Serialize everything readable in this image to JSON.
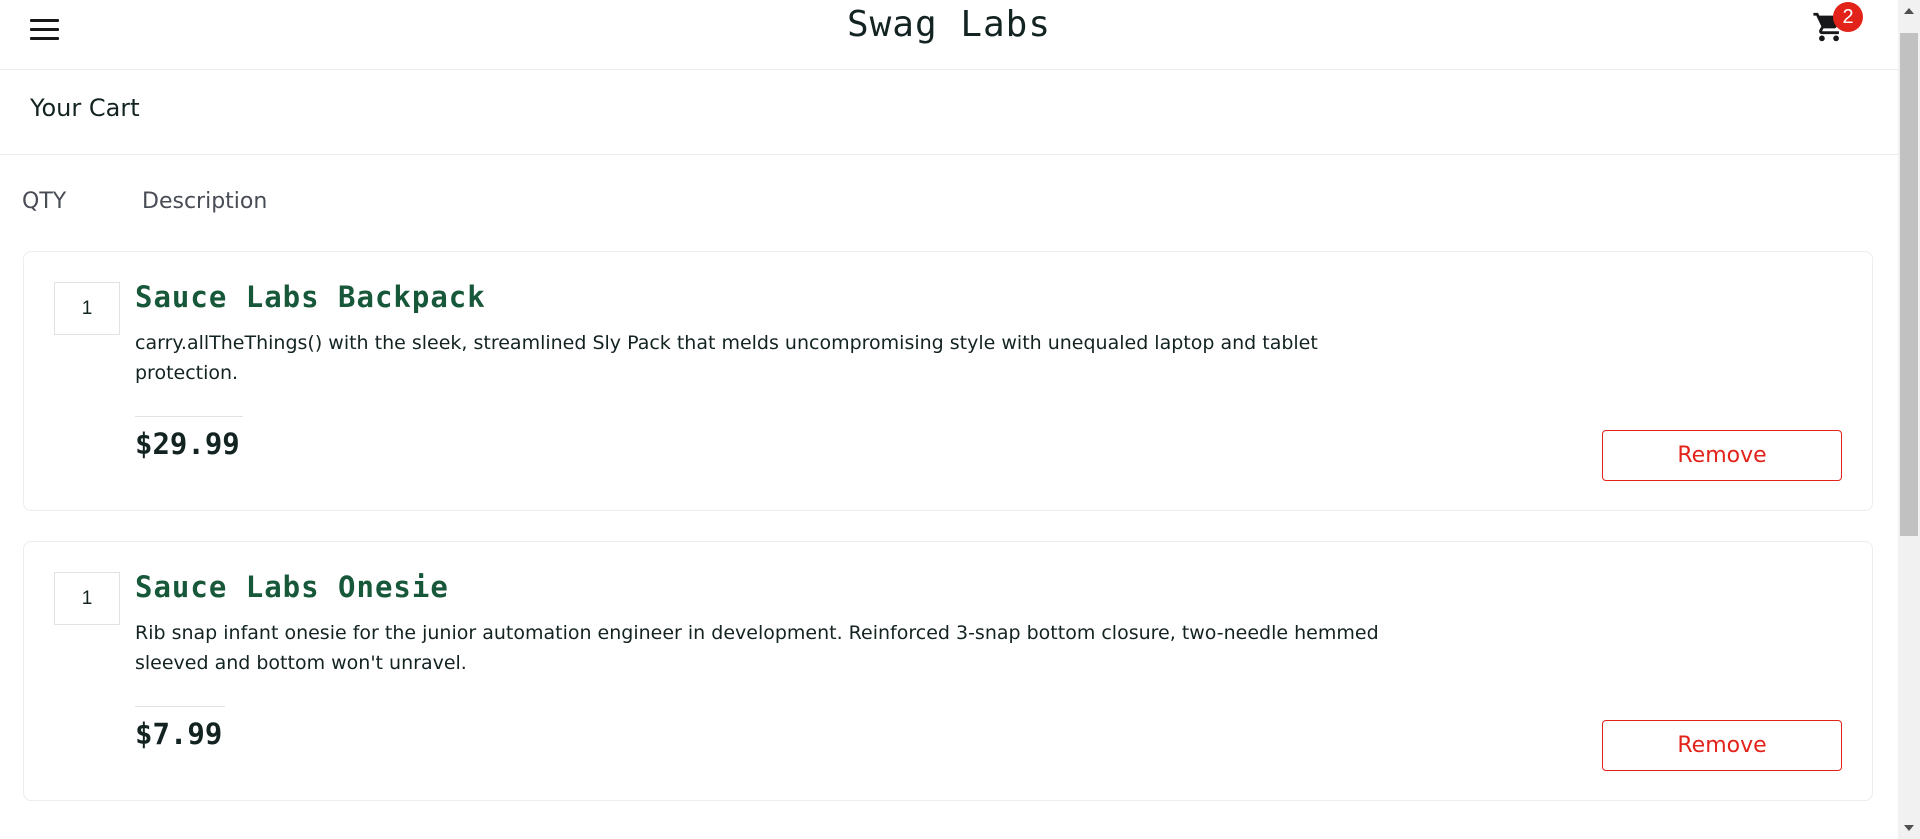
{
  "header": {
    "logo": "Swag Labs",
    "cart_badge": "2"
  },
  "secondary_header": {
    "title": "Your Cart"
  },
  "cart_list": {
    "qty_label": "QTY",
    "desc_label": "Description",
    "items": [
      {
        "quantity": "1",
        "name": "Sauce Labs Backpack",
        "description": "carry.allTheThings() with the sleek, streamlined Sly Pack that melds uncompromising style with unequaled laptop and tablet protection.",
        "price": "$29.99",
        "remove_label": "Remove"
      },
      {
        "quantity": "1",
        "name": "Sauce Labs Onesie",
        "description": "Rib snap infant onesie for the junior automation engineer in development. Reinforced 3-snap bottom closure, two-needle hemmed sleeved and bottom won't unravel.",
        "price": "$7.99",
        "remove_label": "Remove"
      }
    ]
  },
  "icons": {
    "menu": "hamburger-menu-icon",
    "cart": "shopping-cart-icon"
  },
  "colors": {
    "item_name": "#18583a",
    "remove": "#e2231a",
    "badge": "#e2231a"
  }
}
